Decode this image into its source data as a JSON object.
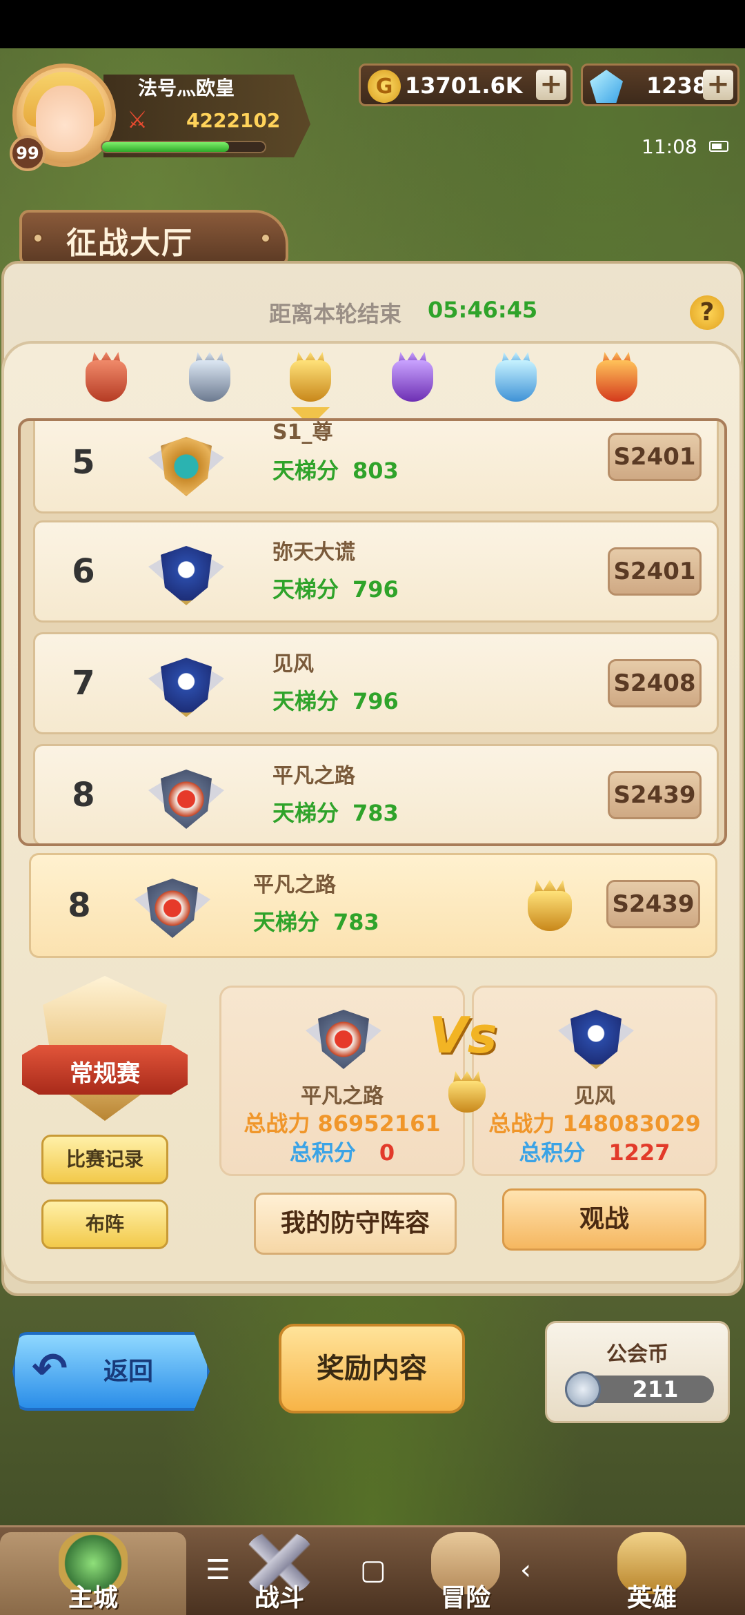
{
  "player": {
    "name": "法号灬欧皇",
    "level": "99",
    "power": "4222102",
    "xp_fraction": 0.78
  },
  "currency": {
    "coins": "13701.6K",
    "gems": "1238",
    "coin_symbol": "G",
    "plus_symbol": "+"
  },
  "status": {
    "time": "11:08"
  },
  "page": {
    "title": "征战大厅",
    "timer_label": "距离本轮结束",
    "timer_value": "05:46:45",
    "help_symbol": "?"
  },
  "tiers": [
    {
      "icon": "bronze-trophy-icon"
    },
    {
      "icon": "silver-trophy-icon"
    },
    {
      "icon": "gold-trophy-icon",
      "selected": true
    },
    {
      "icon": "purple-trophy-icon"
    },
    {
      "icon": "diamond-trophy-icon"
    },
    {
      "icon": "flame-trophy-icon"
    }
  ],
  "ladder_label": "天梯分",
  "rankings": [
    {
      "rank": "5",
      "name": "S1_尊",
      "score": "803",
      "server": "S2401",
      "emblem": "gold"
    },
    {
      "rank": "6",
      "name": "弥天大谎",
      "score": "796",
      "server": "S2401",
      "emblem": "blue"
    },
    {
      "rank": "7",
      "name": "见风",
      "score": "796",
      "server": "S2408",
      "emblem": "blue"
    },
    {
      "rank": "8",
      "name": "平凡之路",
      "score": "783",
      "server": "S2439",
      "emblem": "red"
    }
  ],
  "my_rank": {
    "rank": "8",
    "name": "平凡之路",
    "score": "783",
    "server": "S2439"
  },
  "season": {
    "label": "常规赛",
    "record_button": "比赛记录",
    "lineup_button": "布阵"
  },
  "match": {
    "vs_text": "Vs",
    "power_label": "总战力",
    "score_label": "总积分",
    "left": {
      "name": "平凡之路",
      "power": "86952161",
      "score": "0"
    },
    "right": {
      "name": "见风",
      "power": "148083029",
      "score": "1227"
    }
  },
  "actions": {
    "defense": "我的防守阵容",
    "watch": "观战",
    "back": "返回",
    "reward": "奖励内容"
  },
  "guild": {
    "title": "公会币",
    "value": "211"
  },
  "nav": [
    {
      "label": "主城",
      "active": true
    },
    {
      "label": "战斗"
    },
    {
      "label": "冒险"
    },
    {
      "label": "英雄"
    }
  ],
  "system_nav": {
    "menu": "☰",
    "home": "▢",
    "back": "‹"
  },
  "colors": {
    "ladder_green": "#2fa32a",
    "power_orange": "#f0962a",
    "score_blue": "#3aa3e6",
    "score_red": "#e23a2a"
  }
}
